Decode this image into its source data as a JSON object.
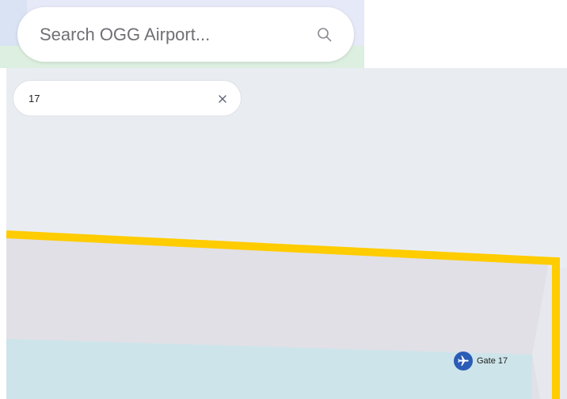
{
  "top_search": {
    "placeholder": "Search OGG Airport...",
    "icon": "search-icon"
  },
  "filter": {
    "value": "17",
    "clear_icon": "close-icon"
  },
  "map": {
    "boundary_color": "#ffcc00",
    "terminal_color": "#e1e0e6",
    "apron_color": "#cde5ea",
    "background_color": "#e9edf2",
    "marker": {
      "label": "Gate 17",
      "icon": "airplane-icon",
      "color": "#2b5cb6"
    }
  }
}
